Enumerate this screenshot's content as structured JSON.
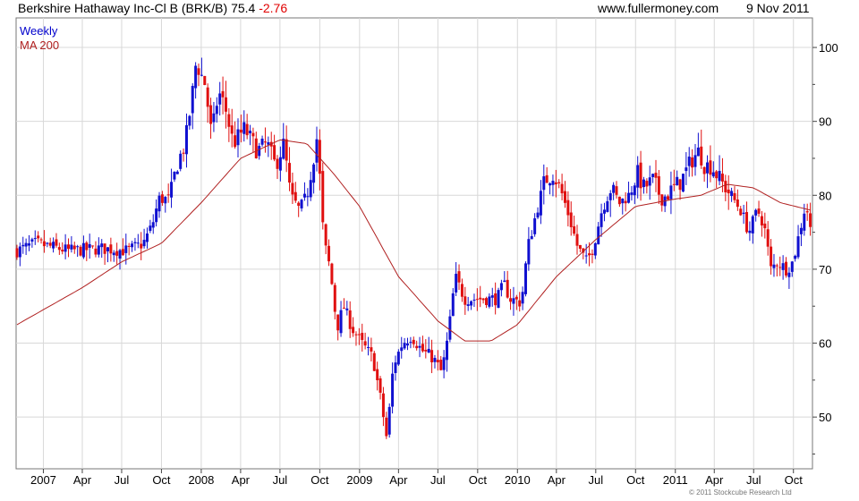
{
  "header": {
    "title": "Berkshire Hathaway Inc-Cl B (BRK/B) 75.4",
    "change": "-2.76",
    "website": "www.fullermoney.com",
    "date": "9 Nov 2011"
  },
  "legend": {
    "weekly": "Weekly",
    "ma": "MA 200"
  },
  "copyright": "© 2011 Stockcube Research Ltd",
  "colors": {
    "up": "#1010d0",
    "down": "#e01010",
    "ma": "#b02020",
    "grid": "#d8d8d8"
  },
  "chart_data": {
    "type": "candlestick",
    "title": "Berkshire Hathaway Inc-Cl B (BRK/B) 75.4 -2.76",
    "frequency": "Weekly",
    "ylim": [
      43,
      104
    ],
    "yticks": [
      50,
      60,
      70,
      80,
      90,
      100
    ],
    "x_range": [
      "2006-10-30",
      "2011-11-14"
    ],
    "xtick_labels": [
      "2007",
      "Apr",
      "Jul",
      "Oct",
      "2008",
      "Apr",
      "Jul",
      "Oct",
      "2009",
      "Apr",
      "Jul",
      "Oct",
      "2010",
      "Apr",
      "Jul",
      "Oct",
      "2011",
      "Apr",
      "Jul",
      "Oct"
    ],
    "xtick_dates": [
      "2007-01-01",
      "2007-04-01",
      "2007-07-01",
      "2007-10-01",
      "2008-01-01",
      "2008-04-01",
      "2008-07-01",
      "2008-10-01",
      "2009-01-01",
      "2009-04-01",
      "2009-07-01",
      "2009-10-01",
      "2010-01-01",
      "2010-04-01",
      "2010-07-01",
      "2010-10-01",
      "2011-01-01",
      "2011-04-01",
      "2011-07-01",
      "2011-10-01"
    ],
    "grid": true,
    "y_axis_side": "right",
    "price_anchors": [
      [
        "2006-11-01",
        72.5
      ],
      [
        "2006-12-15",
        73.5
      ],
      [
        "2007-03-01",
        72.5
      ],
      [
        "2007-05-15",
        72.8
      ],
      [
        "2007-07-15",
        72.5
      ],
      [
        "2007-08-20",
        73.5
      ],
      [
        "2007-09-10",
        76
      ],
      [
        "2007-09-25",
        79.5
      ],
      [
        "2007-10-20",
        79.5
      ],
      [
        "2007-11-05",
        84
      ],
      [
        "2007-11-25",
        87
      ],
      [
        "2007-12-10",
        93
      ],
      [
        "2007-12-20",
        98
      ],
      [
        "2008-01-10",
        95
      ],
      [
        "2008-01-25",
        88
      ],
      [
        "2008-02-10",
        94
      ],
      [
        "2008-02-25",
        92
      ],
      [
        "2008-03-15",
        87
      ],
      [
        "2008-04-10",
        89
      ],
      [
        "2008-05-10",
        86
      ],
      [
        "2008-06-01",
        87
      ],
      [
        "2008-06-20",
        84
      ],
      [
        "2008-07-10",
        87
      ],
      [
        "2008-07-25",
        80
      ],
      [
        "2008-08-15",
        78
      ],
      [
        "2008-09-01",
        80
      ],
      [
        "2008-09-25",
        88
      ],
      [
        "2008-10-10",
        74
      ],
      [
        "2008-10-25",
        70
      ],
      [
        "2008-11-10",
        62
      ],
      [
        "2008-11-25",
        65
      ],
      [
        "2008-12-15",
        62
      ],
      [
        "2009-01-05",
        60
      ],
      [
        "2009-02-01",
        58
      ],
      [
        "2009-02-20",
        52
      ],
      [
        "2009-03-05",
        47
      ],
      [
        "2009-03-20",
        57
      ],
      [
        "2009-04-10",
        60
      ],
      [
        "2009-05-01",
        61
      ],
      [
        "2009-05-25",
        59
      ],
      [
        "2009-06-20",
        58
      ],
      [
        "2009-07-10",
        56
      ],
      [
        "2009-07-25",
        61
      ],
      [
        "2009-08-10",
        69
      ],
      [
        "2009-09-01",
        66
      ],
      [
        "2009-10-15",
        66
      ],
      [
        "2009-11-15",
        66
      ],
      [
        "2009-12-01",
        68
      ],
      [
        "2009-12-15",
        66
      ],
      [
        "2010-01-10",
        65.5
      ],
      [
        "2010-01-25",
        73
      ],
      [
        "2010-02-15",
        78
      ],
      [
        "2010-03-05",
        82
      ],
      [
        "2010-03-25",
        83
      ],
      [
        "2010-04-15",
        80
      ],
      [
        "2010-05-01",
        77
      ],
      [
        "2010-05-20",
        73
      ],
      [
        "2010-06-10",
        71
      ],
      [
        "2010-06-25",
        73
      ],
      [
        "2010-07-15",
        78
      ],
      [
        "2010-08-05",
        81
      ],
      [
        "2010-08-25",
        79
      ],
      [
        "2010-09-15",
        80
      ],
      [
        "2010-10-05",
        83
      ],
      [
        "2010-10-20",
        81
      ],
      [
        "2010-11-10",
        82
      ],
      [
        "2010-12-01",
        79.5
      ],
      [
        "2010-12-20",
        80.5
      ],
      [
        "2011-01-15",
        82
      ],
      [
        "2011-02-10",
        85
      ],
      [
        "2011-02-25",
        86
      ],
      [
        "2011-03-10",
        84
      ],
      [
        "2011-03-25",
        84
      ],
      [
        "2011-04-15",
        82
      ],
      [
        "2011-05-10",
        80
      ],
      [
        "2011-06-01",
        78
      ],
      [
        "2011-06-20",
        75
      ],
      [
        "2011-07-10",
        78
      ],
      [
        "2011-07-25",
        76
      ],
      [
        "2011-08-10",
        70
      ],
      [
        "2011-08-25",
        71
      ],
      [
        "2011-09-15",
        70
      ],
      [
        "2011-09-30",
        71
      ],
      [
        "2011-10-15",
        75
      ],
      [
        "2011-10-30",
        79
      ],
      [
        "2011-11-09",
        75.4
      ]
    ],
    "ma200_anchors": [
      [
        "2006-11-01",
        62.5
      ],
      [
        "2007-04-01",
        67.5
      ],
      [
        "2007-07-01",
        71
      ],
      [
        "2007-10-01",
        73.5
      ],
      [
        "2008-01-01",
        79
      ],
      [
        "2008-04-01",
        85
      ],
      [
        "2008-07-01",
        87.5
      ],
      [
        "2008-09-01",
        87
      ],
      [
        "2008-11-01",
        83
      ],
      [
        "2009-01-01",
        78.5
      ],
      [
        "2009-04-01",
        69
      ],
      [
        "2009-07-01",
        63
      ],
      [
        "2009-09-01",
        60.3
      ],
      [
        "2009-11-01",
        60.3
      ],
      [
        "2010-01-01",
        62.5
      ],
      [
        "2010-04-01",
        69
      ],
      [
        "2010-07-01",
        74
      ],
      [
        "2010-10-01",
        78.5
      ],
      [
        "2011-01-01",
        79.5
      ],
      [
        "2011-03-01",
        80
      ],
      [
        "2011-05-01",
        81.5
      ],
      [
        "2011-07-01",
        81
      ],
      [
        "2011-09-01",
        79
      ],
      [
        "2011-11-09",
        78
      ]
    ]
  }
}
